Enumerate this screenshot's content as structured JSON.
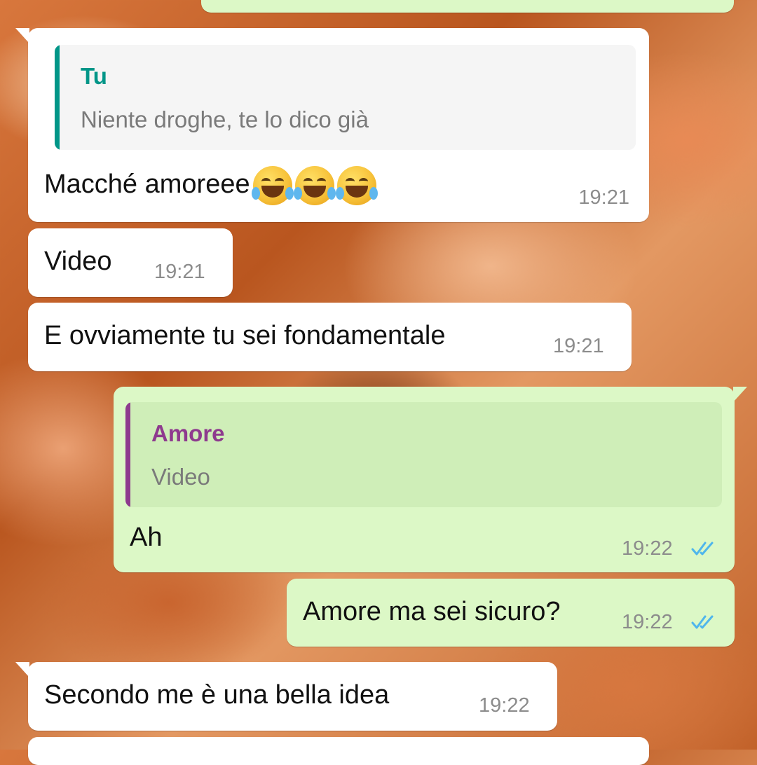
{
  "messages": [
    {
      "id": "m0",
      "direction": "out",
      "text": ""
    },
    {
      "id": "m1",
      "direction": "in",
      "quote": {
        "author": "Tu",
        "text": "Niente droghe, te lo dico già",
        "accent": "#009688"
      },
      "text": "Macché amoreee",
      "emojis": [
        "face-with-tears-of-joy",
        "face-with-tears-of-joy",
        "face-with-tears-of-joy"
      ],
      "time": "19:21"
    },
    {
      "id": "m2",
      "direction": "in",
      "text": "Video",
      "time": "19:21"
    },
    {
      "id": "m3",
      "direction": "in",
      "text": "E ovviamente tu sei fondamentale",
      "time": "19:21"
    },
    {
      "id": "m4",
      "direction": "out",
      "quote": {
        "author": "Amore",
        "text": "Video",
        "accent": "#8e3a8e"
      },
      "text": "Ah",
      "time": "19:22",
      "status": "read"
    },
    {
      "id": "m5",
      "direction": "out",
      "text": "Amore ma sei sicuro?",
      "time": "19:22",
      "status": "read"
    },
    {
      "id": "m6",
      "direction": "in",
      "text": "Secondo me è una bella idea",
      "time": "19:22"
    },
    {
      "id": "m7",
      "direction": "in",
      "text": ""
    }
  ],
  "colors": {
    "incoming_bubble": "#ffffff",
    "outgoing_bubble": "#dcf8c6",
    "read_ticks": "#4fb6ec",
    "timestamp": "#8c8c8c"
  }
}
